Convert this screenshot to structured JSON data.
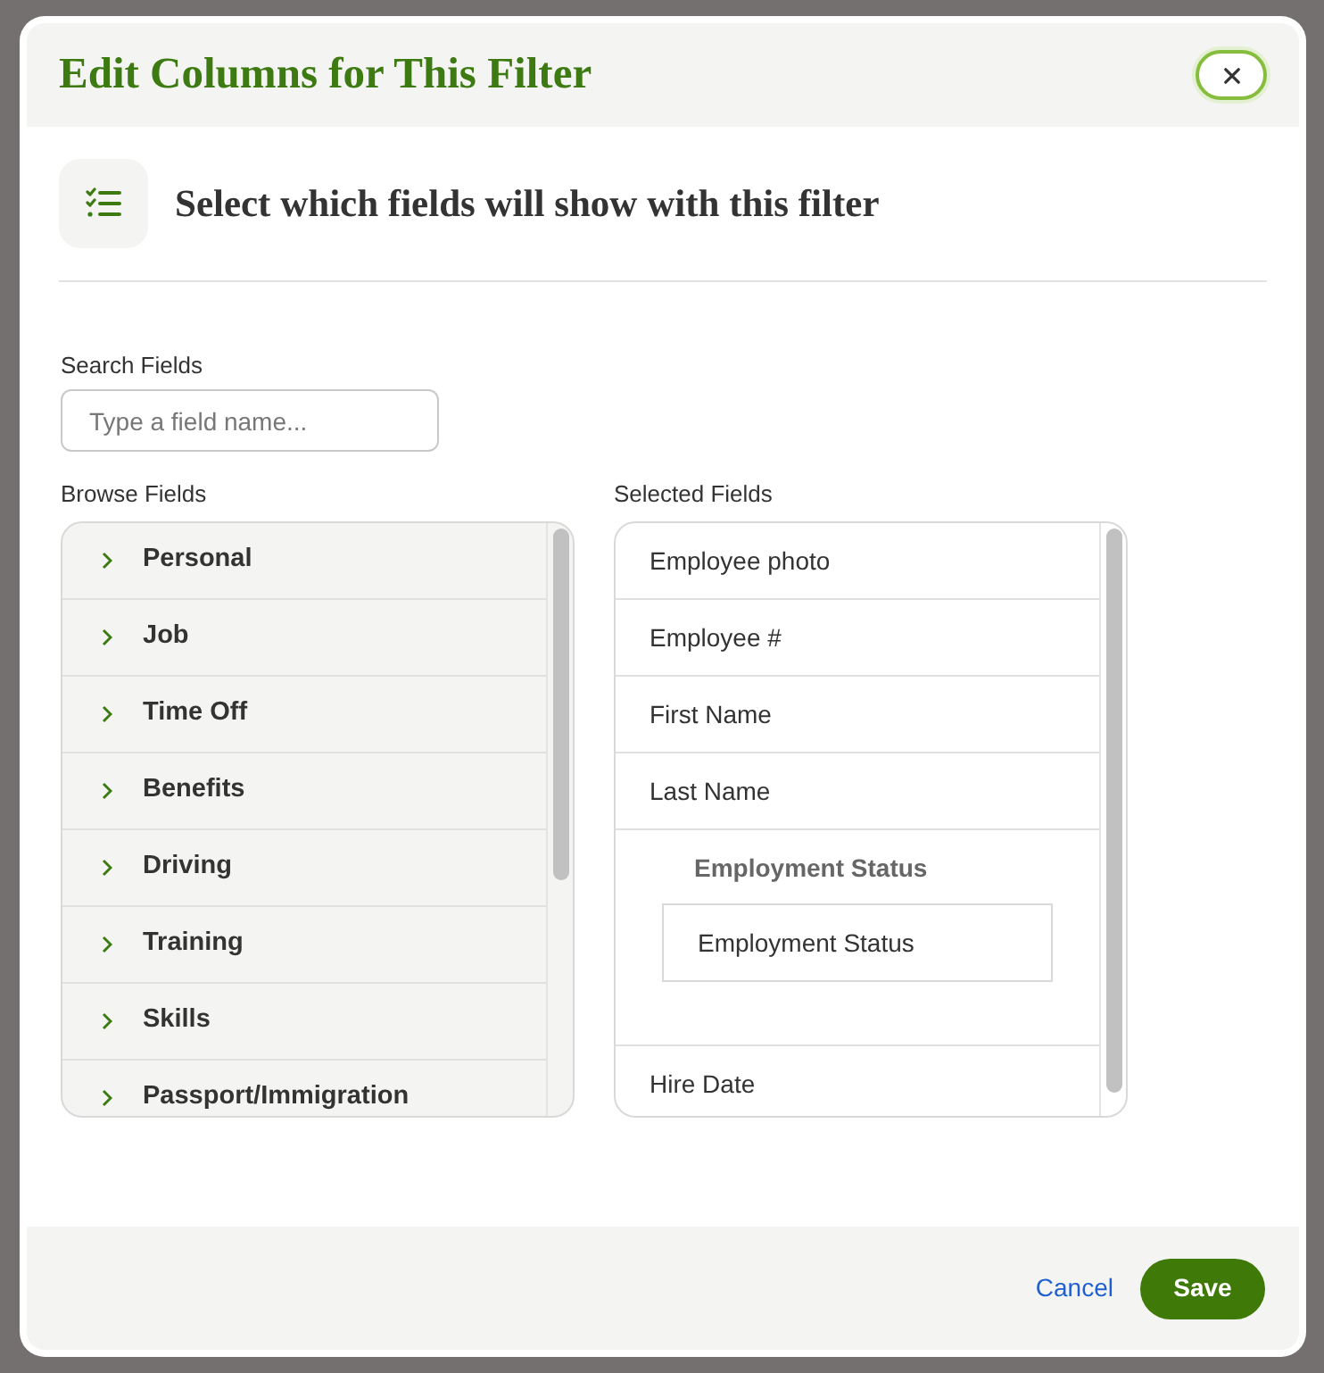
{
  "dialog": {
    "title": "Edit Columns for This Filter"
  },
  "intro": {
    "text": "Select which fields will show with this filter"
  },
  "search": {
    "label": "Search Fields",
    "placeholder": "Type a field name..."
  },
  "browse": {
    "label": "Browse Fields",
    "items": [
      {
        "label": "Personal",
        "expanded": false
      },
      {
        "label": "Job",
        "expanded": false
      },
      {
        "label": "Time Off",
        "expanded": false
      },
      {
        "label": "Benefits",
        "expanded": false
      },
      {
        "label": "Driving",
        "expanded": false
      },
      {
        "label": "Training",
        "expanded": false
      },
      {
        "label": "Skills",
        "expanded": false
      },
      {
        "label": "Passport/Immigration",
        "expanded": false
      }
    ]
  },
  "selected": {
    "label": "Selected Fields",
    "items": [
      {
        "kind": "field",
        "label": "Employee photo"
      },
      {
        "kind": "field",
        "label": "Employee #"
      },
      {
        "kind": "field",
        "label": "First Name"
      },
      {
        "kind": "field",
        "label": "Last Name"
      },
      {
        "kind": "group",
        "label": "Employment Status",
        "children": [
          {
            "label": "Employment Status"
          }
        ]
      },
      {
        "kind": "field",
        "label": "Hire Date"
      }
    ]
  },
  "footer": {
    "buttons": [
      {
        "kind": "link",
        "label": "Cancel"
      },
      {
        "kind": "primary",
        "label": "Save"
      }
    ]
  }
}
